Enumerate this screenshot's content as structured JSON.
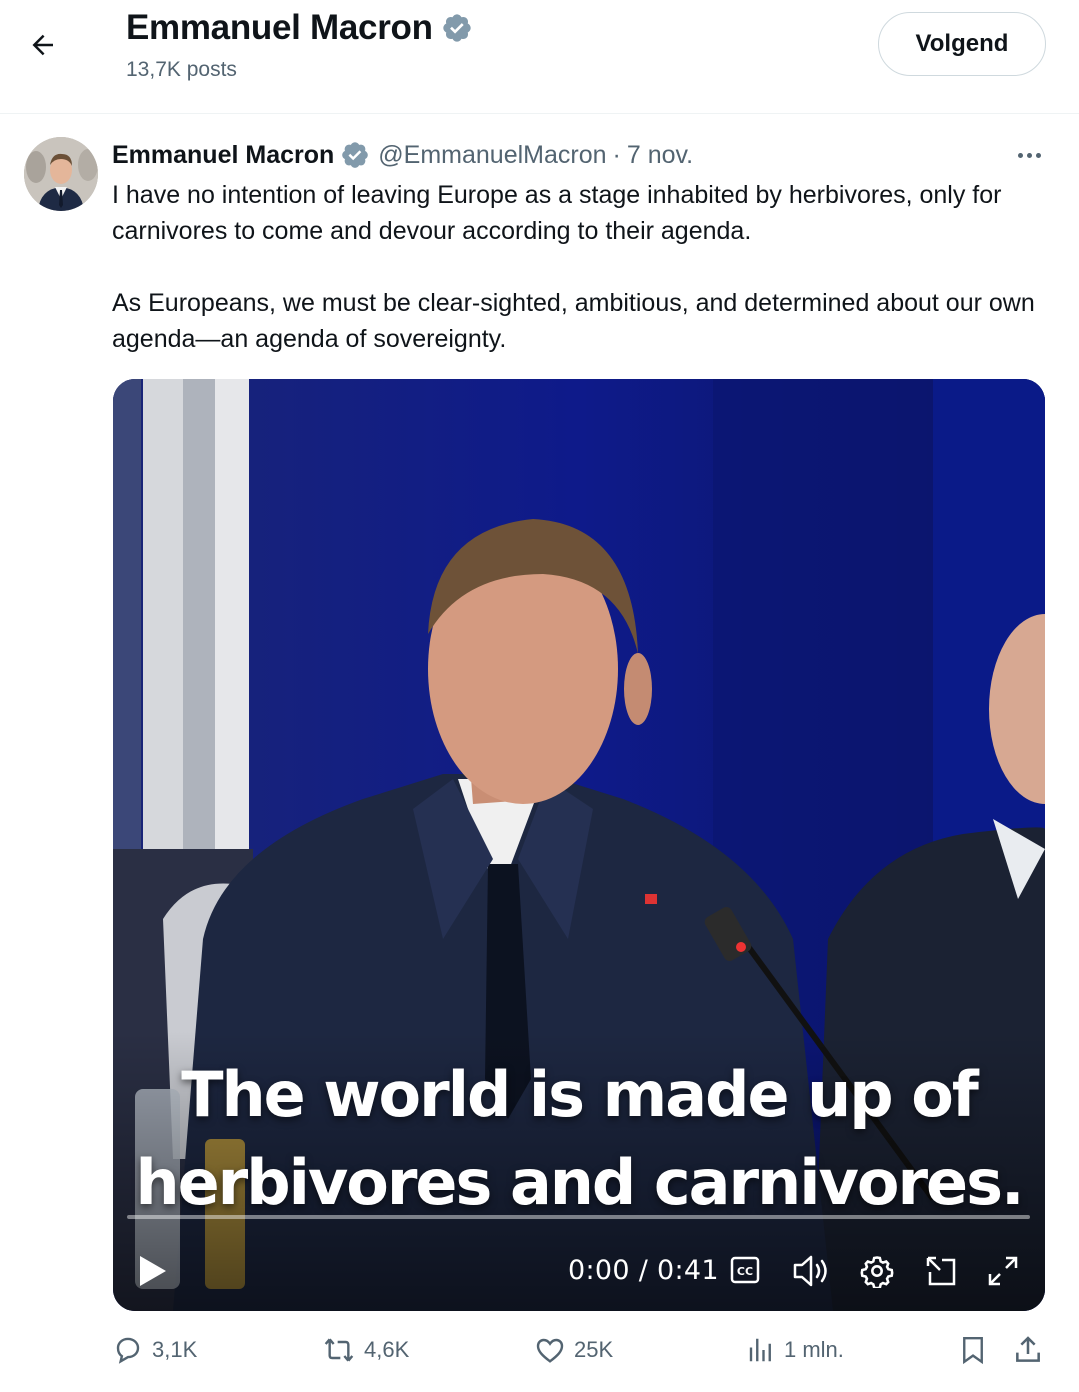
{
  "header": {
    "title": "Emmanuel Macron",
    "subtitle": "13,7K posts",
    "follow_label": "Volgend"
  },
  "post": {
    "author_name": "Emmanuel Macron",
    "handle": "@EmmanuelMacron",
    "separator": "·",
    "date": "7 nov.",
    "paragraphs": [
      "I have no intention of leaving Europe as a stage inhabited by herbivores, only for carnivores to come and devour according to their agenda.",
      "As Europeans, we must be clear-sighted, ambitious, and determined about our own agenda—an agenda of sovereignty."
    ]
  },
  "video": {
    "caption_line1": "The world is made up of",
    "caption_line2": "herbivores and carnivores.",
    "time": "0:00 / 0:41",
    "cc_label": "CC",
    "progress": 0
  },
  "actions": {
    "replies": "3,1K",
    "reposts": "4,6K",
    "likes": "25K",
    "views": "1 mln."
  },
  "colors": {
    "text_primary": "#0f1419",
    "text_secondary": "#536471",
    "verified_badge": "#829aab",
    "video_background": "#0d1660"
  },
  "icons": [
    "back-arrow-icon",
    "verified-icon",
    "more-icon",
    "play-icon",
    "cc-icon",
    "volume-icon",
    "settings-icon",
    "pip-icon",
    "fullscreen-icon",
    "reply-icon",
    "repost-icon",
    "like-icon",
    "views-icon",
    "bookmark-icon",
    "share-icon"
  ]
}
